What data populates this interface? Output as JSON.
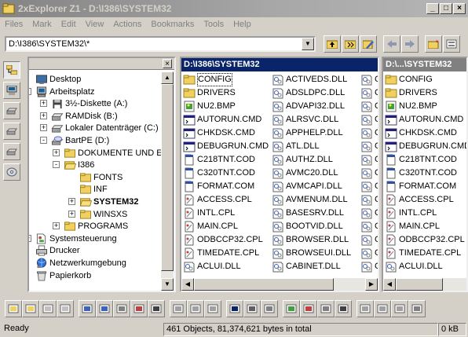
{
  "window": {
    "title": "2xExplorer Z1 - D:\\I386\\SYSTEM32",
    "minimize": "_",
    "maximize": "□",
    "close": "×"
  },
  "menu": [
    "Files",
    "Mark",
    "Edit",
    "View",
    "Actions",
    "Bookmarks",
    "Tools",
    "Help"
  ],
  "address": {
    "value": "D:\\I386\\SYSTEM32\\*"
  },
  "tree": {
    "close": "×",
    "items": [
      {
        "label": "Desktop",
        "icon": "desktop",
        "depth": 0,
        "pm": ""
      },
      {
        "label": "Arbeitsplatz",
        "icon": "computer",
        "depth": 1,
        "pm": "-"
      },
      {
        "label": "3½-Diskette (A:)",
        "icon": "floppy",
        "depth": 2,
        "pm": "+"
      },
      {
        "label": "RAMDisk (B:)",
        "icon": "drive",
        "depth": 2,
        "pm": "+"
      },
      {
        "label": "Lokaler Datenträger (C:)",
        "icon": "drive",
        "depth": 2,
        "pm": "+"
      },
      {
        "label": "BartPE (D:)",
        "icon": "cdrom",
        "depth": 2,
        "pm": "-"
      },
      {
        "label": "DOKUMENTE UND EI",
        "icon": "folder",
        "depth": 3,
        "pm": "+"
      },
      {
        "label": "I386",
        "icon": "folder-open",
        "depth": 3,
        "pm": "-"
      },
      {
        "label": "FONTS",
        "icon": "folder",
        "depth": 4,
        "pm": ""
      },
      {
        "label": "INF",
        "icon": "folder",
        "depth": 4,
        "pm": ""
      },
      {
        "label": "SYSTEM32",
        "icon": "folder-open",
        "depth": 4,
        "pm": "+",
        "bold": true
      },
      {
        "label": "WINSXS",
        "icon": "folder",
        "depth": 4,
        "pm": "+"
      },
      {
        "label": "PROGRAMS",
        "icon": "folder",
        "depth": 3,
        "pm": "+"
      },
      {
        "label": "Systemsteuerung",
        "icon": "control-panel",
        "depth": 1,
        "pm": "+"
      },
      {
        "label": "Drucker",
        "icon": "printer",
        "depth": 1,
        "pm": ""
      },
      {
        "label": "Netzwerkumgebung",
        "icon": "network",
        "depth": 0,
        "pm": ""
      },
      {
        "label": "Papierkorb",
        "icon": "recycle-bin",
        "depth": 0,
        "pm": ""
      }
    ]
  },
  "main_pane": {
    "header": "D:\\I386\\SYSTEM32",
    "columns": [
      [
        {
          "name": "CONFIG",
          "icon": "folder",
          "selected": true
        },
        {
          "name": "DRIVERS",
          "icon": "folder"
        },
        {
          "name": "NU2.BMP",
          "icon": "bmp"
        },
        {
          "name": "AUTORUN.CMD",
          "icon": "cmd"
        },
        {
          "name": "CHKDSK.CMD",
          "icon": "cmd"
        },
        {
          "name": "DEBUGRUN.CMD",
          "icon": "cmd"
        },
        {
          "name": "C218TNT.COD",
          "icon": "file"
        },
        {
          "name": "C320TNT.COD",
          "icon": "file"
        },
        {
          "name": "FORMAT.COM",
          "icon": "file"
        },
        {
          "name": "ACCESS.CPL",
          "icon": "cpl"
        },
        {
          "name": "INTL.CPL",
          "icon": "cpl"
        },
        {
          "name": "MAIN.CPL",
          "icon": "cpl"
        },
        {
          "name": "ODBCCP32.CPL",
          "icon": "cpl"
        },
        {
          "name": "TIMEDATE.CPL",
          "icon": "cpl"
        },
        {
          "name": "ACLUI.DLL",
          "icon": "dll"
        }
      ],
      [
        {
          "name": "ACTIVEDS.DLL",
          "icon": "dll"
        },
        {
          "name": "ADSLDPC.DLL",
          "icon": "dll"
        },
        {
          "name": "ADVAPI32.DLL",
          "icon": "dll"
        },
        {
          "name": "ALRSVC.DLL",
          "icon": "dll"
        },
        {
          "name": "APPHELP.DLL",
          "icon": "dll"
        },
        {
          "name": "ATL.DLL",
          "icon": "dll"
        },
        {
          "name": "AUTHZ.DLL",
          "icon": "dll"
        },
        {
          "name": "AVMC20.DLL",
          "icon": "dll"
        },
        {
          "name": "AVMCAPI.DLL",
          "icon": "dll"
        },
        {
          "name": "AVMENUM.DLL",
          "icon": "dll"
        },
        {
          "name": "BASESRV.DLL",
          "icon": "dll"
        },
        {
          "name": "BOOTVID.DLL",
          "icon": "dll"
        },
        {
          "name": "BROWSER.DLL",
          "icon": "dll"
        },
        {
          "name": "BROWSEUI.DLL",
          "icon": "dll"
        },
        {
          "name": "CABINET.DLL",
          "icon": "dll"
        }
      ],
      [
        {
          "name": "CI",
          "icon": "dll"
        },
        {
          "name": "CI",
          "icon": "dll"
        },
        {
          "name": "CI",
          "icon": "dll"
        },
        {
          "name": "CI",
          "icon": "dll"
        },
        {
          "name": "CI",
          "icon": "dll"
        },
        {
          "name": "CI",
          "icon": "dll"
        },
        {
          "name": "CI",
          "icon": "dll"
        },
        {
          "name": "CI",
          "icon": "dll"
        },
        {
          "name": "CI",
          "icon": "dll"
        },
        {
          "name": "CI",
          "icon": "dll"
        },
        {
          "name": "C:",
          "icon": "dll"
        },
        {
          "name": "C:",
          "icon": "dll"
        },
        {
          "name": "C:",
          "icon": "dll"
        },
        {
          "name": "C:",
          "icon": "dll"
        },
        {
          "name": "CI",
          "icon": "dll"
        }
      ]
    ]
  },
  "side_pane": {
    "header": "D:\\...\\SYSTEM32",
    "items": [
      {
        "name": "CONFIG",
        "icon": "folder"
      },
      {
        "name": "DRIVERS",
        "icon": "folder"
      },
      {
        "name": "NU2.BMP",
        "icon": "bmp"
      },
      {
        "name": "AUTORUN.CMD",
        "icon": "cmd"
      },
      {
        "name": "CHKDSK.CMD",
        "icon": "cmd"
      },
      {
        "name": "DEBUGRUN.CMD",
        "icon": "cmd"
      },
      {
        "name": "C218TNT.COD",
        "icon": "file"
      },
      {
        "name": "C320TNT.COD",
        "icon": "file"
      },
      {
        "name": "FORMAT.COM",
        "icon": "file"
      },
      {
        "name": "ACCESS.CPL",
        "icon": "cpl"
      },
      {
        "name": "INTL.CPL",
        "icon": "cpl"
      },
      {
        "name": "MAIN.CPL",
        "icon": "cpl"
      },
      {
        "name": "ODBCCP32.CPL",
        "icon": "cpl"
      },
      {
        "name": "TIMEDATE.CPL",
        "icon": "cpl"
      },
      {
        "name": "ACLUI.DLL",
        "icon": "dll"
      }
    ]
  },
  "status": {
    "ready": "Ready",
    "summary": "461 Objects, 81,374,621 bytes in total",
    "size": "0 kB"
  },
  "colors": {
    "accent": "#0a246a",
    "inactive_header": "#808080",
    "folder": "#f0d060"
  }
}
